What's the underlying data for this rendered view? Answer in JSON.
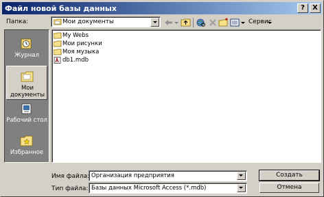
{
  "window": {
    "title": "Файл новой базы данных",
    "help_label": "?",
    "close_label": "X"
  },
  "toolbar": {
    "folder_label": "Папка:",
    "folder_value": "Мои документы",
    "tools_label": "Сервис"
  },
  "places": [
    {
      "label": "Журнал",
      "icon": "history-icon"
    },
    {
      "label": "Мои документы",
      "icon": "my-documents-folder-icon"
    },
    {
      "label": "Рабочий стол",
      "icon": "desktop-icon"
    },
    {
      "label": "Избранное",
      "icon": "favorites-icon"
    }
  ],
  "files": [
    {
      "name": "My Webs",
      "icon": "folder-icon"
    },
    {
      "name": "Мои рисунки",
      "icon": "folder-icon"
    },
    {
      "name": "Моя музыка",
      "icon": "folder-icon"
    },
    {
      "name": "db1.mdb",
      "icon": "access-db-icon"
    }
  ],
  "form": {
    "filename_label": "Имя файла:",
    "filename_value": "Организация предприятия",
    "filetype_label": "Тип файла:",
    "filetype_value": "Базы данных Microsoft Access (*.mdb)",
    "create_label": "Создать",
    "cancel_label": "Отмена"
  }
}
